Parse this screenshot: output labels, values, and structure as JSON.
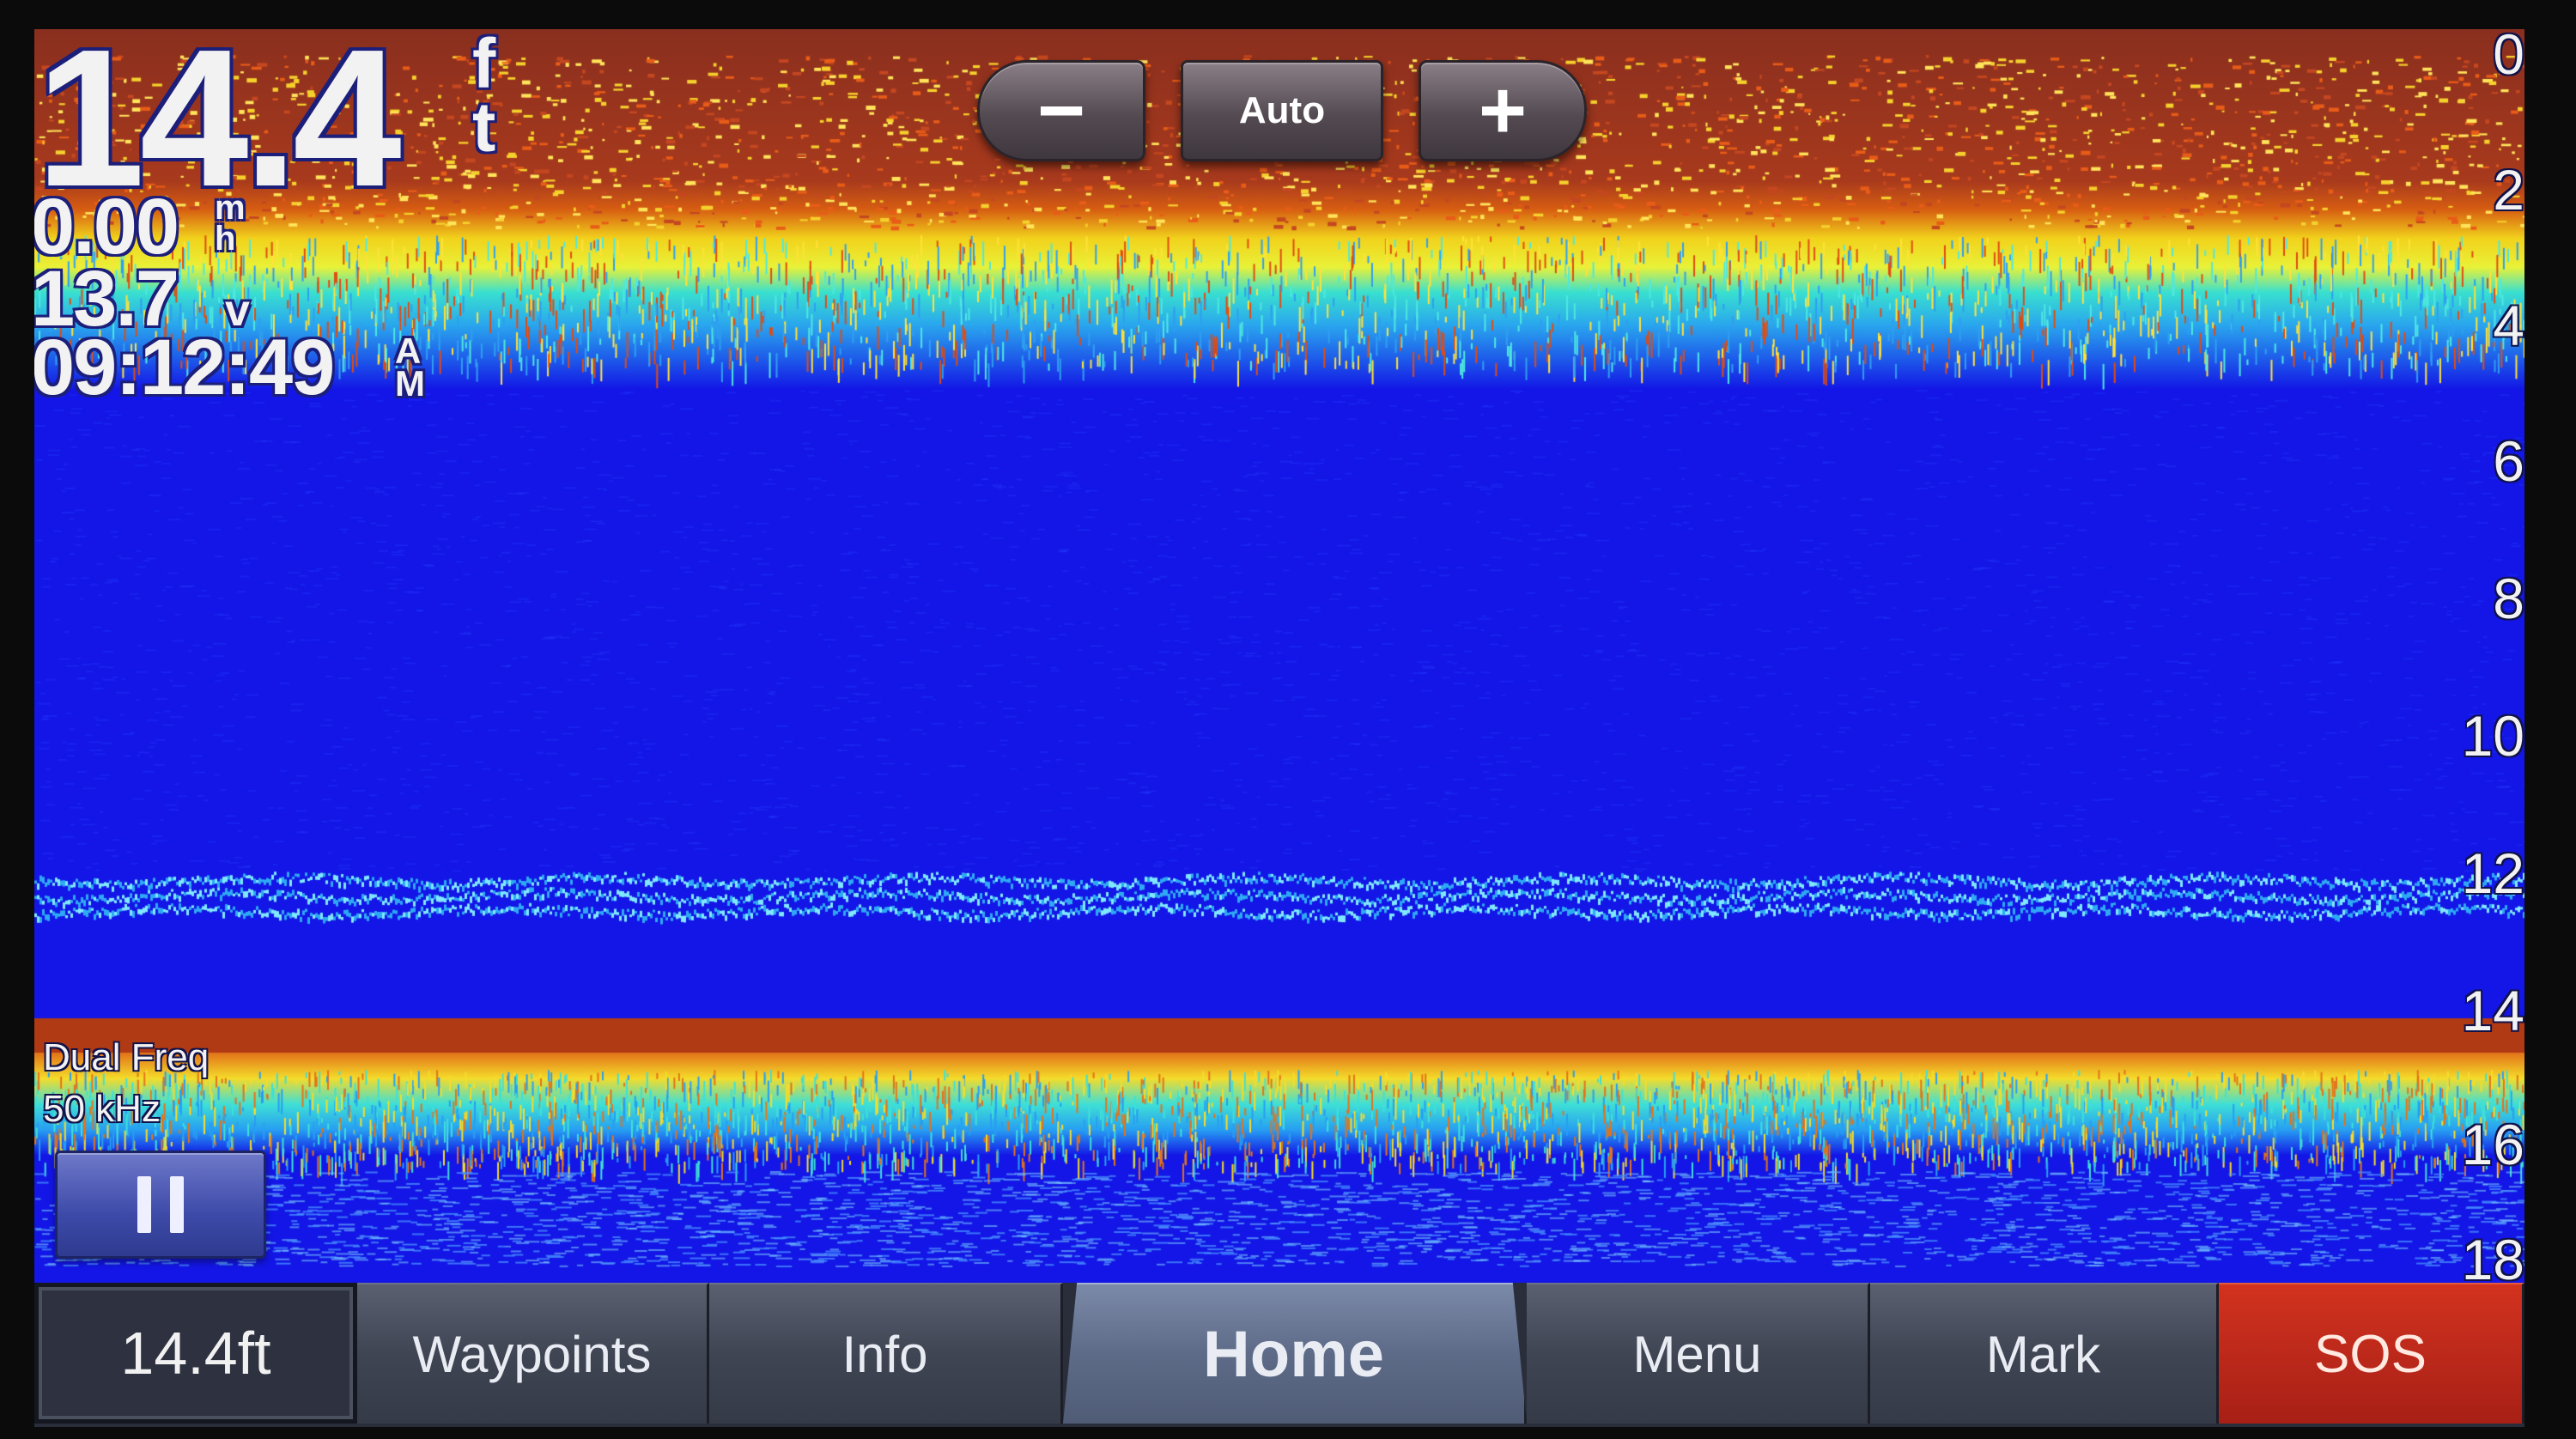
{
  "readouts": {
    "depth_value": "14.4",
    "depth_unit_top": "f",
    "depth_unit_bottom": "t",
    "speed_value": "0.00",
    "speed_unit_top": "m",
    "speed_unit_bottom": "h",
    "voltage_value": "13.7",
    "voltage_unit": "v",
    "time_value": "09:12:49",
    "time_unit_top": "A",
    "time_unit_bottom": "M"
  },
  "controls": {
    "zoom_out": "−",
    "auto": "Auto",
    "zoom_in": "+"
  },
  "depth_scale": [
    "0",
    "2",
    "4",
    "6",
    "8",
    "10",
    "12",
    "14",
    "16",
    "18"
  ],
  "sonar": {
    "mode": "Dual Freq",
    "frequency": "50 kHz"
  },
  "navbar": {
    "depth": "14.4ft",
    "waypoints": "Waypoints",
    "info": "Info",
    "home": "Home",
    "menu": "Menu",
    "mark": "Mark",
    "sos": "SOS"
  },
  "colors": {
    "water": "#1316e6",
    "surface_clutter": "#a8361f",
    "bottom_return": "#b03a14",
    "sos": "#c22a1b"
  }
}
